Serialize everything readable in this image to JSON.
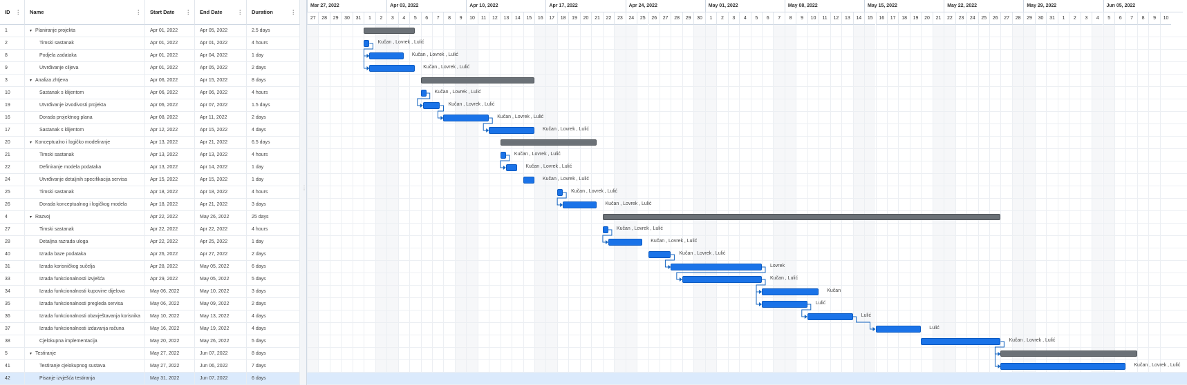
{
  "grid": {
    "columns": [
      {
        "key": "id",
        "label": "ID"
      },
      {
        "key": "name",
        "label": "Name"
      },
      {
        "key": "start",
        "label": "Start Date"
      },
      {
        "key": "end",
        "label": "End Date"
      },
      {
        "key": "duration",
        "label": "Duration"
      }
    ],
    "rows": [
      {
        "id": "1",
        "name": "Planiranje projekta",
        "start": "Apr 01, 2022",
        "end": "Apr 05, 2022",
        "duration": "2.5 days",
        "summary": true,
        "level": 0
      },
      {
        "id": "2",
        "name": "Timski sastanak",
        "start": "Apr 01, 2022",
        "end": "Apr 01, 2022",
        "duration": "4 hours",
        "level": 1
      },
      {
        "id": "8",
        "name": "Podjela zadataka",
        "start": "Apr 01, 2022",
        "end": "Apr 04, 2022",
        "duration": "1 day",
        "level": 1
      },
      {
        "id": "9",
        "name": "Utvrđivanje ciljeva",
        "start": "Apr 01, 2022",
        "end": "Apr 05, 2022",
        "duration": "2 days",
        "level": 1
      },
      {
        "id": "3",
        "name": "Analiza zhtjeva",
        "start": "Apr 06, 2022",
        "end": "Apr 15, 2022",
        "duration": "8 days",
        "summary": true,
        "level": 0
      },
      {
        "id": "10",
        "name": "Sastanak s klijentom",
        "start": "Apr 06, 2022",
        "end": "Apr 06, 2022",
        "duration": "4 hours",
        "level": 1
      },
      {
        "id": "19",
        "name": "Utvrđivanje izvodivosti projekta",
        "start": "Apr 06, 2022",
        "end": "Apr 07, 2022",
        "duration": "1.5 days",
        "level": 1
      },
      {
        "id": "16",
        "name": "Dorada projektnog plana",
        "start": "Apr 08, 2022",
        "end": "Apr 11, 2022",
        "duration": "2 days",
        "level": 1
      },
      {
        "id": "17",
        "name": "Sastanak s klijentom",
        "start": "Apr 12, 2022",
        "end": "Apr 15, 2022",
        "duration": "4 days",
        "level": 1
      },
      {
        "id": "20",
        "name": "Konceptualno i logičko modeliranje",
        "start": "Apr 13, 2022",
        "end": "Apr 21, 2022",
        "duration": "6.5 days",
        "summary": true,
        "level": 0
      },
      {
        "id": "21",
        "name": "Timski sastanak",
        "start": "Apr 13, 2022",
        "end": "Apr 13, 2022",
        "duration": "4 hours",
        "level": 1
      },
      {
        "id": "22",
        "name": "Definiranje modela podataka",
        "start": "Apr 13, 2022",
        "end": "Apr 14, 2022",
        "duration": "1 day",
        "level": 1
      },
      {
        "id": "24",
        "name": "Utvrđivanje detaljnih specifikacija servisa",
        "start": "Apr 15, 2022",
        "end": "Apr 15, 2022",
        "duration": "1 day",
        "level": 1
      },
      {
        "id": "25",
        "name": "Timski sastanak",
        "start": "Apr 18, 2022",
        "end": "Apr 18, 2022",
        "duration": "4 hours",
        "level": 1
      },
      {
        "id": "26",
        "name": "Dorada konceptualnog i logičkog modela",
        "start": "Apr 18, 2022",
        "end": "Apr 21, 2022",
        "duration": "3 days",
        "level": 1
      },
      {
        "id": "4",
        "name": "Razvoj",
        "start": "Apr 22, 2022",
        "end": "May 26, 2022",
        "duration": "25 days",
        "summary": true,
        "level": 0
      },
      {
        "id": "27",
        "name": "Timski sastanak",
        "start": "Apr 22, 2022",
        "end": "Apr 22, 2022",
        "duration": "4 hours",
        "level": 1
      },
      {
        "id": "28",
        "name": "Detaljna razrada uloga",
        "start": "Apr 22, 2022",
        "end": "Apr 25, 2022",
        "duration": "1 day",
        "level": 1
      },
      {
        "id": "40",
        "name": "Izrada baze podataka",
        "start": "Apr 26, 2022",
        "end": "Apr 27, 2022",
        "duration": "2 days",
        "level": 1
      },
      {
        "id": "31",
        "name": "Izrada korisničkog sučelja",
        "start": "Apr 28, 2022",
        "end": "May 05, 2022",
        "duration": "6 days",
        "level": 1
      },
      {
        "id": "33",
        "name": "Izrada funkcionalnosti izvješća",
        "start": "Apr 29, 2022",
        "end": "May 05, 2022",
        "duration": "5 days",
        "level": 1
      },
      {
        "id": "34",
        "name": "Izrada funkcionalnosti kupovine dijelova",
        "start": "May 06, 2022",
        "end": "May 10, 2022",
        "duration": "3 days",
        "level": 1
      },
      {
        "id": "35",
        "name": "Izrada funkcionalnosti pregleda servisa",
        "start": "May 06, 2022",
        "end": "May 09, 2022",
        "duration": "2 days",
        "level": 1
      },
      {
        "id": "36",
        "name": "Izrada funkcionalnosti obavještavanja korisnika",
        "start": "May 10, 2022",
        "end": "May 13, 2022",
        "duration": "4 days",
        "level": 1
      },
      {
        "id": "37",
        "name": "Izrada funkcionalnosti izdavanja računa",
        "start": "May 16, 2022",
        "end": "May 19, 2022",
        "duration": "4 days",
        "level": 1
      },
      {
        "id": "38",
        "name": "Cjelokupna implementacija",
        "start": "May 20, 2022",
        "end": "May 26, 2022",
        "duration": "5 days",
        "level": 1
      },
      {
        "id": "5",
        "name": "Testiranje",
        "start": "May 27, 2022",
        "end": "Jun 07, 2022",
        "duration": "8 days",
        "summary": true,
        "level": 0
      },
      {
        "id": "41",
        "name": "Testiranje cjelokupnog sustava",
        "start": "May 27, 2022",
        "end": "Jun 06, 2022",
        "duration": "7 days",
        "level": 1
      },
      {
        "id": "42",
        "name": "Pisanje izvješća testiranja",
        "start": "May 31, 2022",
        "end": "Jun 07, 2022",
        "duration": "6 days",
        "level": 1,
        "selected": true
      }
    ]
  },
  "timeline": {
    "months": [
      "Mar 27, 2022",
      "Apr 03, 2022",
      "Apr 10, 2022",
      "Apr 17, 2022",
      "Apr 24, 2022",
      "May 01, 2022",
      "May 08, 2022",
      "May 15, 2022",
      "May 22, 2022",
      "May 29, 2022",
      "Jun 05, 2022"
    ],
    "days": [
      "27",
      "28",
      "29",
      "30",
      "31",
      "1",
      "2",
      "3",
      "4",
      "5",
      "6",
      "7",
      "8",
      "9",
      "10",
      "11",
      "12",
      "13",
      "14",
      "15",
      "16",
      "17",
      "18",
      "19",
      "20",
      "21",
      "22",
      "23",
      "24",
      "25",
      "26",
      "27",
      "28",
      "29",
      "30",
      "1",
      "2",
      "3",
      "4",
      "5",
      "6",
      "7",
      "8",
      "9",
      "10",
      "11",
      "12",
      "13",
      "14",
      "15",
      "16",
      "17",
      "18",
      "19",
      "20",
      "21",
      "22",
      "23",
      "24",
      "25",
      "26",
      "27",
      "28",
      "29",
      "30",
      "31",
      "1",
      "2",
      "3",
      "4",
      "5",
      "6",
      "7",
      "8",
      "9",
      "10"
    ]
  },
  "bars": [
    {
      "row": 0,
      "start": 5.0,
      "end": 9.5,
      "type": "summary",
      "label": ""
    },
    {
      "row": 1,
      "start": 5.0,
      "end": 5.5,
      "type": "task",
      "label": "Kučan , Lovrek , Lulić"
    },
    {
      "row": 2,
      "start": 5.5,
      "end": 8.5,
      "type": "task",
      "label": "Kučan , Lovrek , Lulić"
    },
    {
      "row": 3,
      "start": 5.5,
      "end": 9.5,
      "type": "task",
      "label": "Kučan , Lovrek , Lulić"
    },
    {
      "row": 4,
      "start": 10.0,
      "end": 20.0,
      "type": "summary",
      "label": ""
    },
    {
      "row": 5,
      "start": 10.0,
      "end": 10.5,
      "type": "task",
      "label": "Kučan , Lovrek , Lulić"
    },
    {
      "row": 6,
      "start": 10.2,
      "end": 11.7,
      "type": "task",
      "label": "Kučan , Lovrek , Lulić"
    },
    {
      "row": 7,
      "start": 12.0,
      "end": 16.0,
      "type": "task",
      "label": "Kučan , Lovrek , Lulić"
    },
    {
      "row": 8,
      "start": 16.0,
      "end": 20.0,
      "type": "task",
      "label": "Kučan , Lovrek , Lulić"
    },
    {
      "row": 9,
      "start": 17.0,
      "end": 25.5,
      "type": "summary",
      "label": ""
    },
    {
      "row": 10,
      "start": 17.0,
      "end": 17.5,
      "type": "task",
      "label": "Kučan , Lovrek , Lulić"
    },
    {
      "row": 11,
      "start": 17.5,
      "end": 18.5,
      "type": "task",
      "label": "Kučan , Lovrek , Lulić"
    },
    {
      "row": 12,
      "start": 19.0,
      "end": 20.0,
      "type": "task",
      "label": "Kučan , Lovrek , Lulić"
    },
    {
      "row": 13,
      "start": 22.0,
      "end": 22.5,
      "type": "task",
      "label": "Kučan , Lovrek , Lulić"
    },
    {
      "row": 14,
      "start": 22.5,
      "end": 25.5,
      "type": "task",
      "label": "Kučan , Lovrek , Lulić"
    },
    {
      "row": 15,
      "start": 26.0,
      "end": 61.0,
      "type": "summary",
      "label": ""
    },
    {
      "row": 16,
      "start": 26.0,
      "end": 26.5,
      "type": "task",
      "label": "Kučan , Lovrek , Lulić"
    },
    {
      "row": 17,
      "start": 26.5,
      "end": 29.5,
      "type": "task",
      "label": "Kučan , Lovrek , Lulić"
    },
    {
      "row": 18,
      "start": 30.0,
      "end": 32.0,
      "type": "task",
      "label": "Kučan , Lovrek , Lulić"
    },
    {
      "row": 19,
      "start": 32.0,
      "end": 40.0,
      "type": "task",
      "label": "Lovrek"
    },
    {
      "row": 20,
      "start": 33.0,
      "end": 40.0,
      "type": "task",
      "label": "Kučan , Lulić"
    },
    {
      "row": 21,
      "start": 40.0,
      "end": 45.0,
      "type": "task",
      "label": "Kučan"
    },
    {
      "row": 22,
      "start": 40.0,
      "end": 44.0,
      "type": "task",
      "label": "Lulić"
    },
    {
      "row": 23,
      "start": 44.0,
      "end": 48.0,
      "type": "task",
      "label": "Lulić"
    },
    {
      "row": 24,
      "start": 50.0,
      "end": 54.0,
      "type": "task",
      "label": "Lulić"
    },
    {
      "row": 25,
      "start": 54.0,
      "end": 61.0,
      "type": "task",
      "label": "Kučan , Lovrek , Lulić"
    },
    {
      "row": 26,
      "start": 61.0,
      "end": 73.0,
      "type": "summary",
      "label": ""
    },
    {
      "row": 27,
      "start": 61.0,
      "end": 72.0,
      "type": "task",
      "label": "Kučan , Lovrek , Lulić"
    }
  ],
  "links": [
    [
      1,
      2
    ],
    [
      1,
      3
    ],
    [
      5,
      6
    ],
    [
      6,
      7
    ],
    [
      7,
      8
    ],
    [
      10,
      11
    ],
    [
      13,
      14
    ],
    [
      16,
      17
    ],
    [
      18,
      19
    ],
    [
      19,
      20
    ],
    [
      20,
      21
    ],
    [
      20,
      22
    ],
    [
      22,
      23
    ],
    [
      23,
      24
    ],
    [
      25,
      26
    ],
    [
      25,
      27
    ]
  ],
  "colors": {
    "task": "#1a73e8",
    "summary": "#6b7177",
    "link": "#1565c0",
    "selection": "#dbeafc"
  }
}
